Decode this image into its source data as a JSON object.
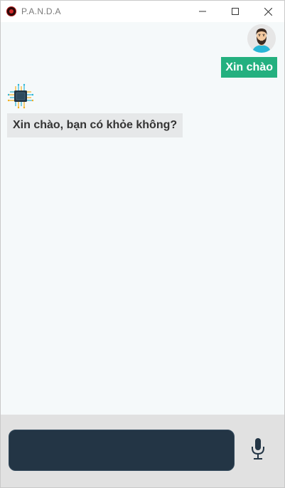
{
  "window": {
    "title": "P.A.N.D.A",
    "icons": {
      "app": "panda-app-icon",
      "minimize": "minimize-icon",
      "maximize": "maximize-icon",
      "close": "close-icon"
    }
  },
  "chat": {
    "messages": [
      {
        "sender": "user",
        "text": "Xin chào",
        "avatar_icon": "user-bearded-avatar-icon"
      },
      {
        "sender": "bot",
        "text": "Xin chào, bạn có khỏe không?",
        "avatar_icon": "cpu-chip-icon"
      }
    ]
  },
  "input": {
    "value": "",
    "placeholder": "",
    "mic_icon": "microphone-icon"
  },
  "colors": {
    "chat_background": "#f5f9fa",
    "user_bubble": "#24b07f",
    "bot_bubble": "#e6e8e9",
    "input_bar": "#e1e1e1",
    "input_field": "#233545",
    "mic": "#233545"
  }
}
